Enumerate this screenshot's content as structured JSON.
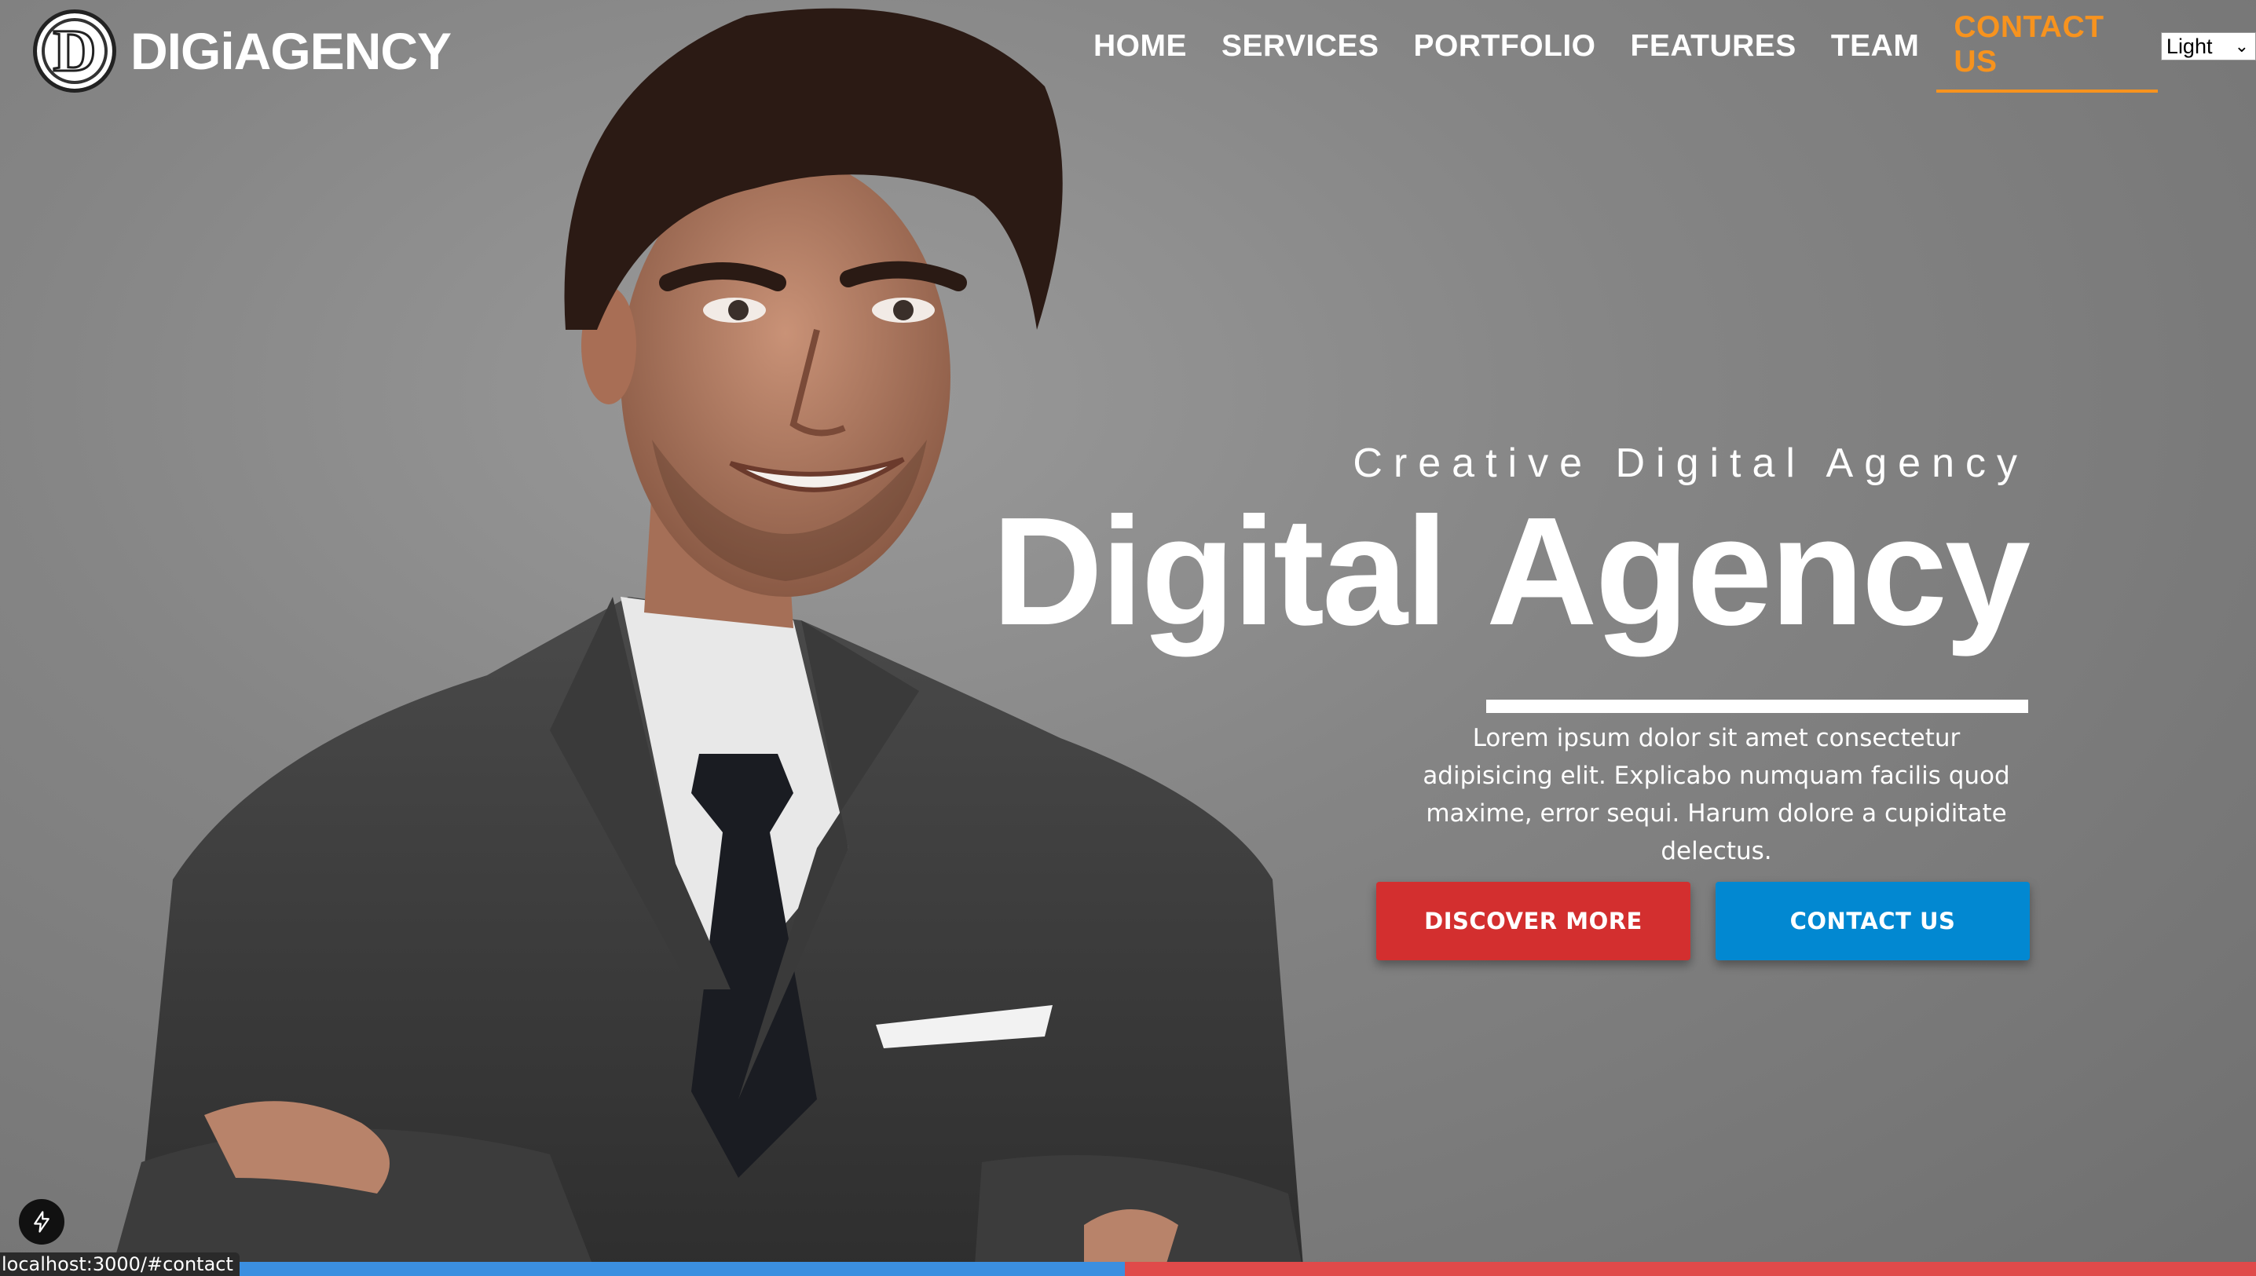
{
  "brand": {
    "logo_letter": "D",
    "name": "DIGiAGENCY"
  },
  "nav": {
    "items": [
      {
        "label": "HOME"
      },
      {
        "label": "SERVICES"
      },
      {
        "label": "PORTFOLIO"
      },
      {
        "label": "FEATURES"
      },
      {
        "label": "TEAM"
      },
      {
        "label": "CONTACT US",
        "active": true
      }
    ],
    "theme_select": {
      "value": "Light"
    }
  },
  "hero": {
    "eyebrow": "Creative Digital Agency",
    "headline_a": "Digital",
    "headline_b": "Agency",
    "lead": "Lorem ipsum dolor sit amet consectetur adipisicing elit. Explicabo numquam facilis quod maxime, error sequi. Harum dolore a cupiditate delectus.",
    "primary_button": "DISCOVER MORE",
    "secondary_button": "CONTACT US"
  },
  "browser": {
    "status_url": "localhost:3000/#contact"
  },
  "colors": {
    "accent": "#f7931e",
    "primary": "#d32f2f",
    "secondary": "#0288d1"
  }
}
